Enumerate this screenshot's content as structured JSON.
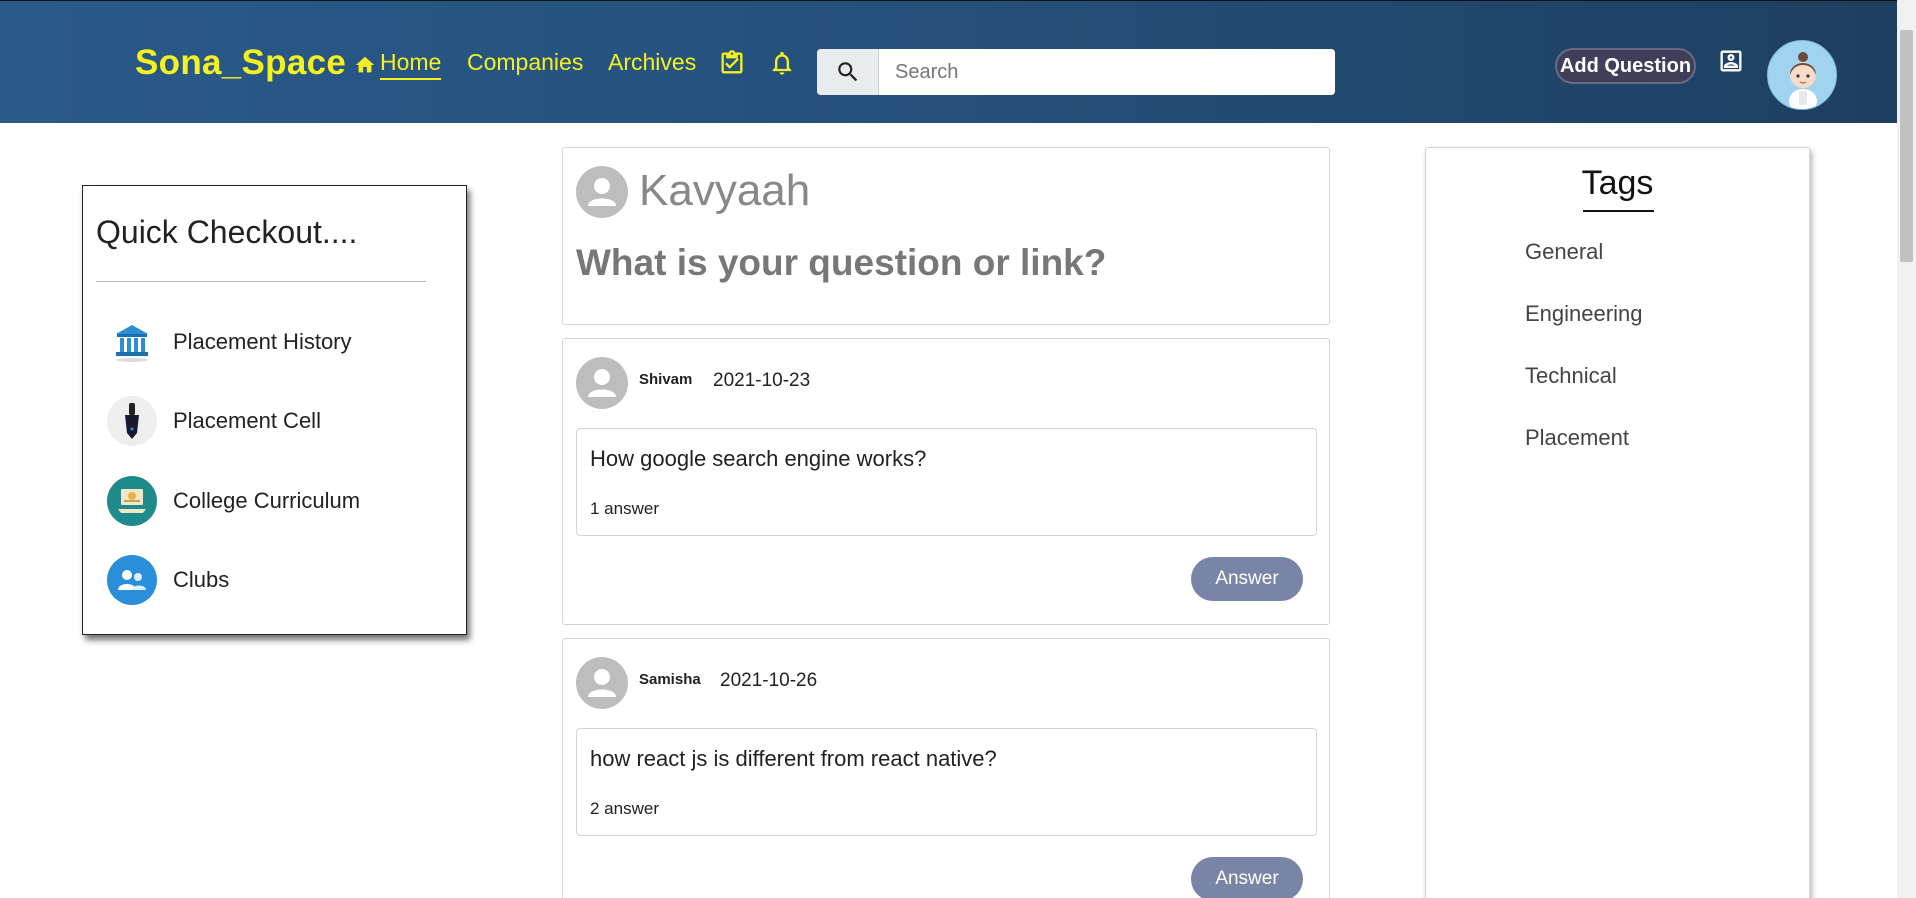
{
  "header": {
    "brand": "Sona_Space",
    "nav": {
      "home": "Home",
      "companies": "Companies",
      "archives": "Archives"
    },
    "search_placeholder": "Search",
    "add_question_label": "Add Question"
  },
  "quick_checkout": {
    "title": "Quick Checkout....",
    "items": [
      {
        "label": "Placement History",
        "icon": "bank-icon"
      },
      {
        "label": "Placement Cell",
        "icon": "fountain-pen-icon"
      },
      {
        "label": "College Curriculum",
        "icon": "certificate-icon"
      },
      {
        "label": "Clubs",
        "icon": "group-icon"
      }
    ]
  },
  "ask_box": {
    "user": "Kavyaah",
    "prompt": "What is your question or link?"
  },
  "posts": [
    {
      "user": "Shivam",
      "date": "2021-10-23",
      "question": "How google search engine works?",
      "answers": "1 answer",
      "answer_button": "Answer"
    },
    {
      "user": "Samisha",
      "date": "2021-10-26",
      "question": "how react js is different from react native?",
      "answers": "2 answer",
      "answer_button": "Answer"
    }
  ],
  "tags": {
    "title": "Tags",
    "items": [
      "General",
      "Engineering",
      "Technical",
      "Placement"
    ]
  },
  "colors": {
    "header_start": "#2a5a8a",
    "header_end": "#1d3f60",
    "brand_yellow": "#f5f020",
    "answer_button": "#7a84a6"
  }
}
